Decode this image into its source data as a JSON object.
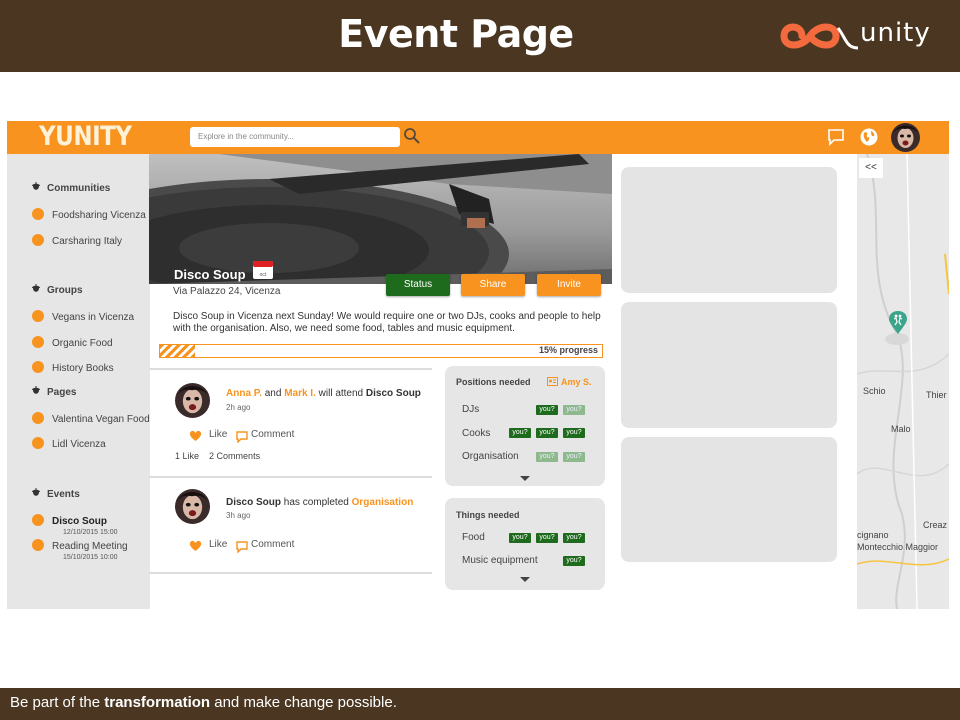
{
  "slide": {
    "title": "Event Page",
    "brand_text": "unity",
    "footer_pre": "Be part of the ",
    "footer_bold": "transformation",
    "footer_post": " and make change possible."
  },
  "topbar": {
    "logo": "YUNITY",
    "search_placeholder": "Explore in the community...",
    "icons": [
      "search-icon",
      "chat-icon",
      "globe-icon",
      "avatar"
    ]
  },
  "sidebar": {
    "communities_label": "Communities",
    "communities": [
      "Foodsharing Vicenza",
      "Carsharing Italy"
    ],
    "groups_label": "Groups",
    "groups": [
      "Vegans in Vicenza",
      "Organic Food",
      "History Books"
    ],
    "pages_label": "Pages",
    "pages": [
      "Valentina Vegan Food",
      "Lidl Vicenza"
    ],
    "events_label": "Events",
    "events": [
      {
        "name": "Disco Soup",
        "date": "12/10/2015  15:00",
        "active": true
      },
      {
        "name": "Reading Meeting",
        "date": "15/10/2015  10:00",
        "active": false
      }
    ]
  },
  "event": {
    "title": "Disco Soup",
    "calendar_month": "oct",
    "address": "Via Palazzo 24, Vicenza",
    "description": "Disco Soup in Vicenza next Sunday! We would require one or two DJs, cooks and people to help with the organisation. Also, we need some food, tables and music equipment.",
    "buttons": {
      "status": "Status",
      "share": "Share",
      "invite": "Invite"
    },
    "progress_label": "15% progress",
    "progress_value": 0.08
  },
  "feed": [
    {
      "name1": "Anna P.",
      "and": " and ",
      "name2": "Mark I.",
      "mid": " will attend ",
      "target": "Disco Soup",
      "time": "2h ago",
      "like": "Like",
      "comment": "Comment",
      "likes": "1 Like",
      "comments": "2 Comments"
    },
    {
      "actor": "Disco Soup",
      "mid": " has completed ",
      "target": "Organisation",
      "time": "3h ago",
      "like": "Like",
      "comment": "Comment"
    }
  ],
  "positions": {
    "title": "Positions needed",
    "assignee": "Amy S.",
    "rows": [
      {
        "label": "DJs",
        "tags": [
          {
            "t": "you?",
            "on": true
          },
          {
            "t": "you?",
            "on": false
          }
        ]
      },
      {
        "label": "Cooks",
        "tags": [
          {
            "t": "you?",
            "on": true
          },
          {
            "t": "you?",
            "on": true
          },
          {
            "t": "you?",
            "on": true
          }
        ]
      },
      {
        "label": "Organisation",
        "tags": [
          {
            "t": "you?",
            "on": false
          },
          {
            "t": "you?",
            "on": false
          }
        ]
      }
    ]
  },
  "things": {
    "title": "Things needed",
    "rows": [
      {
        "label": "Food",
        "tags": [
          {
            "t": "you?",
            "on": true
          },
          {
            "t": "you?",
            "on": true
          },
          {
            "t": "you?",
            "on": true
          }
        ]
      },
      {
        "label": "Music equipment",
        "tags": [
          {
            "t": "you?",
            "on": true
          }
        ]
      }
    ]
  },
  "map": {
    "collapse": "<<",
    "labels": [
      "Schio",
      "Thier",
      "Malo",
      "Creaz",
      "cignano",
      "Montecchio Maggior"
    ]
  },
  "colors": {
    "brown": "#4b3621",
    "orange": "#f7931e",
    "green": "#1e6b1e",
    "panel_gray": "#e6e6e6"
  }
}
